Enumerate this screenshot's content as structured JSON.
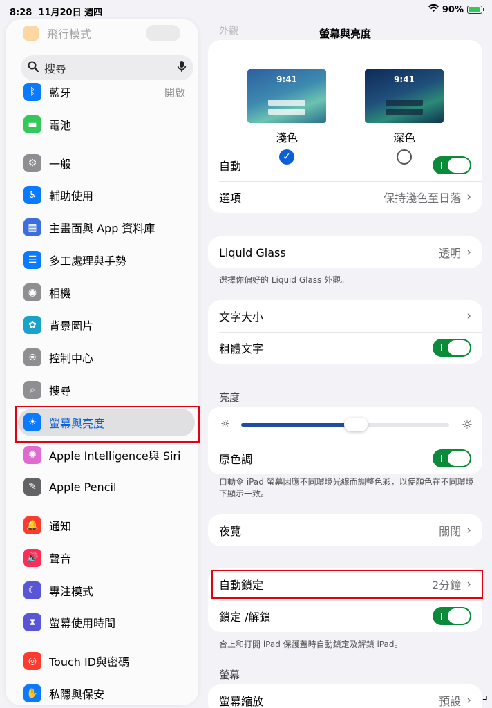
{
  "status": {
    "time": "8:28",
    "date": "11月20日 週四",
    "battery": "90%",
    "battery_level": 0.9
  },
  "sidebar": {
    "faded_item": "飛行模式",
    "search_placeholder": "搜尋",
    "items": [
      {
        "label": "藍牙",
        "value": "開啟",
        "icon": "bluetooth-icon",
        "color": "#0a7aff",
        "glyph": "ᛒ"
      },
      {
        "label": "電池",
        "icon": "battery-icon",
        "color": "#34c759",
        "glyph": "▬"
      },
      {
        "label": "一般",
        "icon": "gear-icon",
        "color": "#8e8e93",
        "glyph": "⚙"
      },
      {
        "label": "輔助使用",
        "icon": "accessibility-icon",
        "color": "#0a7aff",
        "glyph": "♿"
      },
      {
        "label": "主畫面與 App 資料庫",
        "icon": "home-screen-icon",
        "color": "#3b6fe0",
        "glyph": "▦"
      },
      {
        "label": "多工處理與手勢",
        "icon": "multitasking-icon",
        "color": "#0a7aff",
        "glyph": "☰"
      },
      {
        "label": "相機",
        "icon": "camera-icon",
        "color": "#8e8e93",
        "glyph": "◉"
      },
      {
        "label": "背景圖片",
        "icon": "wallpaper-icon",
        "color": "#1aa3c9",
        "glyph": "✿"
      },
      {
        "label": "控制中心",
        "icon": "control-center-icon",
        "color": "#8e8e93",
        "glyph": "⊜"
      },
      {
        "label": "搜尋",
        "icon": "search-icon",
        "color": "#8e8e93",
        "glyph": "⌕"
      },
      {
        "label": "螢幕與亮度",
        "icon": "brightness-icon",
        "color": "#0a7aff",
        "glyph": "☀",
        "selected": true
      },
      {
        "label": "Apple Intelligence與 Siri",
        "icon": "apple-intelligence-icon",
        "color": "#e06bd0",
        "glyph": "✺"
      },
      {
        "label": "Apple Pencil",
        "icon": "pencil-icon",
        "color": "#636366",
        "glyph": "✎"
      },
      {
        "label": "通知",
        "icon": "bell-icon",
        "color": "#ff3b30",
        "glyph": "🔔"
      },
      {
        "label": "聲音",
        "icon": "speaker-icon",
        "color": "#ff2d55",
        "glyph": "🔊"
      },
      {
        "label": "專注模式",
        "icon": "moon-icon",
        "color": "#5856d6",
        "glyph": "☾"
      },
      {
        "label": "螢幕使用時間",
        "icon": "hourglass-icon",
        "color": "#5856d6",
        "glyph": "⧗"
      },
      {
        "label": "Touch ID與密碼",
        "icon": "fingerprint-icon",
        "color": "#ff3b30",
        "glyph": "◎"
      },
      {
        "label": "私隱與保安",
        "icon": "hand-icon",
        "color": "#0a7aff",
        "glyph": "✋"
      }
    ]
  },
  "main": {
    "title": "螢幕與亮度",
    "ghost_header": "外觀",
    "appearance": {
      "light_label": "淺色",
      "dark_label": "深色",
      "thumb_time": "9:41",
      "selected": "light",
      "auto_label": "自動",
      "auto_on": true,
      "options_label": "選項",
      "options_value": "保持淺色至日落"
    },
    "liquid_glass": {
      "label": "Liquid Glass",
      "value": "透明",
      "footer": "選擇你偏好的 Liquid Glass 外觀。"
    },
    "text": {
      "size_label": "文字大小",
      "bold_label": "粗體文字",
      "bold_on": true
    },
    "brightness": {
      "header": "亮度",
      "level": 0.55,
      "true_tone_label": "原色調",
      "true_tone_on": true,
      "footer": "自動令 iPad 螢幕因應不同環境光線而調整色彩，以使顏色在不同環境下顯示一致。"
    },
    "night_shift": {
      "label": "夜覽",
      "value": "關閉"
    },
    "lock": {
      "auto_lock_label": "自動鎖定",
      "auto_lock_value": "2分鐘",
      "lock_unlock_label": "鎖定 /解鎖",
      "lock_unlock_on": true,
      "footer": "合上和打開 iPad 保護蓋時自動鎖定及解鎖 iPad。"
    },
    "display": {
      "header": "螢幕",
      "zoom_label": "螢幕縮放",
      "zoom_value": "預設"
    }
  }
}
